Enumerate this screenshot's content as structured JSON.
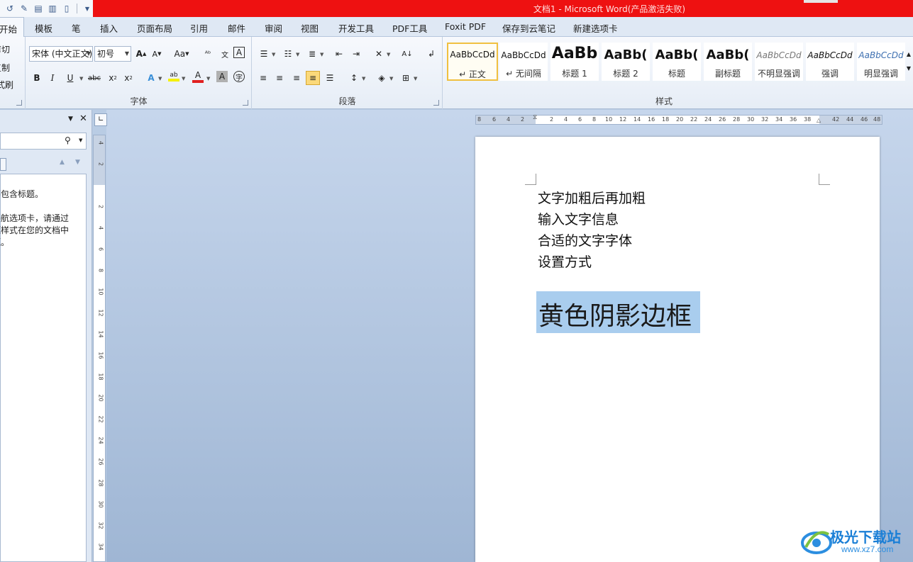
{
  "window": {
    "title": "文档1 - Microsoft Word(产品激活失败)"
  },
  "tabs": [
    "开始",
    "模板",
    "笔",
    "插入",
    "页面布局",
    "引用",
    "邮件",
    "审阅",
    "视图",
    "开发工具",
    "PDF工具",
    "Foxit PDF",
    "保存到云笔记",
    "新建选项卡"
  ],
  "clipboard": {
    "cut": "剪切",
    "copy": "复制",
    "format_painter": "格式刷"
  },
  "font": {
    "group_label": "字体",
    "font_name": "宋体 (中文正文)",
    "font_size": "初号",
    "colors": {
      "highlight": "#f5f000",
      "font_color": "#e02020",
      "text_effect": "#3a8fd8"
    }
  },
  "paragraph": {
    "group_label": "段落"
  },
  "styles": {
    "group_label": "样式",
    "items": [
      {
        "sample": "AaBbCcDd",
        "name": "↵ 正文"
      },
      {
        "sample": "AaBbCcDd",
        "name": "↵ 无间隔"
      },
      {
        "sample": "AaBb",
        "name": "标题 1"
      },
      {
        "sample": "AaBb(",
        "name": "标题 2"
      },
      {
        "sample": "AaBb(",
        "name": "标题"
      },
      {
        "sample": "AaBb(",
        "name": "副标题"
      },
      {
        "sample": "AaBbCcDd",
        "name": "不明显强调"
      },
      {
        "sample": "AaBbCcDd",
        "name": "强调"
      },
      {
        "sample": "AaBbCcDd",
        "name": "明显强调"
      }
    ]
  },
  "nav_pane": {
    "lines": [
      "不包含标题。",
      "导航选项卡，请通过",
      "标题样式在您的文档中",
      "标题。"
    ]
  },
  "ruler": {
    "h_ticks": [
      "8",
      "6",
      "4",
      "2",
      "2",
      "4",
      "6",
      "8",
      "10",
      "12",
      "14",
      "16",
      "18",
      "20",
      "22",
      "24",
      "26",
      "28",
      "30",
      "32",
      "34",
      "36",
      "38",
      "42",
      "44",
      "46",
      "48"
    ],
    "v_ticks": [
      "4",
      "2",
      "2",
      "4",
      "6",
      "8",
      "10",
      "12",
      "14",
      "16",
      "18",
      "20",
      "22",
      "24",
      "26",
      "28",
      "30",
      "32",
      "34"
    ]
  },
  "document": {
    "lines": [
      "文字加粗后再加粗",
      "输入文字信息",
      "合适的文字字体",
      "设置方式"
    ],
    "highlighted_text": "黄色阴影边框",
    "selection_color": "#a9cdee"
  },
  "watermark": {
    "title": "极光下载站",
    "url": "www.xz7.com"
  }
}
